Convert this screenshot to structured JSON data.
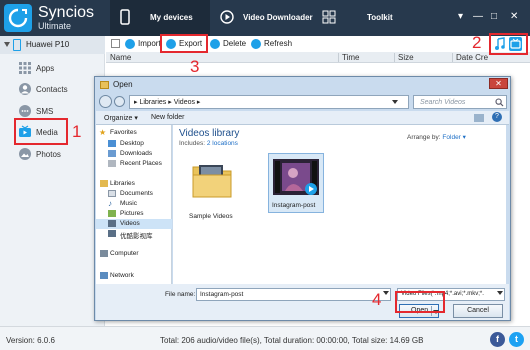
{
  "app": {
    "title": "Syncios",
    "subtitle": "Ultimate",
    "tabs": [
      {
        "label": "My devices",
        "icon": "phone-icon"
      },
      {
        "label": "Video Downloader",
        "icon": "play-icon"
      },
      {
        "label": "Toolkit",
        "icon": "grid-icon"
      }
    ],
    "window_controls": [
      "▾",
      "—",
      "□",
      "✕"
    ],
    "accent": "#1ea0e8",
    "header_bg": "#27394d",
    "highlight": "#e4282e"
  },
  "sidebar": {
    "device": "Huawei P10",
    "items": [
      {
        "label": "Apps",
        "icon": "apps-icon"
      },
      {
        "label": "Contacts",
        "icon": "contacts-icon"
      },
      {
        "label": "SMS",
        "icon": "sms-icon"
      },
      {
        "label": "Media",
        "icon": "media-icon"
      },
      {
        "label": "Photos",
        "icon": "photos-icon"
      }
    ]
  },
  "toolbar": {
    "import": "Import",
    "export": "Export",
    "delete": "Delete",
    "refresh": "Refresh"
  },
  "list_header": {
    "name": "Name",
    "time": "Time",
    "size": "Size",
    "date": "Date Cre"
  },
  "annotations": {
    "one": "1",
    "two": "2",
    "three": "3",
    "four": "4"
  },
  "dialog": {
    "title": "Open",
    "close": "✕",
    "path": "▸  Libraries  ▸  Videos  ▸",
    "search_placeholder": "Search Videos",
    "organize": "Organize ▾",
    "new_folder": "New folder",
    "nav": [
      {
        "label": "Favorites",
        "icon": "star-icon",
        "group": true
      },
      {
        "label": "Desktop",
        "icon": "desktop-icon",
        "group": false
      },
      {
        "label": "Downloads",
        "icon": "downloads-icon",
        "group": false
      },
      {
        "label": "Recent Places",
        "icon": "recent-icon",
        "group": false
      },
      {
        "label": "Libraries",
        "icon": "libraries-icon",
        "group": true
      },
      {
        "label": "Documents",
        "icon": "documents-icon",
        "group": false
      },
      {
        "label": "Music",
        "icon": "music-icon",
        "group": false
      },
      {
        "label": "Pictures",
        "icon": "pictures-icon",
        "group": false
      },
      {
        "label": "Videos",
        "icon": "videos-icon",
        "group": false
      },
      {
        "label": "优酷影视库",
        "icon": "library-icon",
        "group": false
      },
      {
        "label": "Computer",
        "icon": "computer-icon",
        "group": true
      },
      {
        "label": "Network",
        "icon": "network-icon",
        "group": true
      }
    ],
    "library_title": "Videos library",
    "library_includes": "Includes:",
    "library_locations": "2 locations",
    "arrange_label": "Arrange by:",
    "arrange_value": "Folder ▾",
    "items": [
      {
        "label": "Sample Videos",
        "icon": "folder-icon"
      },
      {
        "label": "Instagram-post",
        "icon": "video-thumbnail"
      }
    ],
    "file_name_label": "File name:",
    "file_name_value": "Instagram-post",
    "file_type": "Video Files(*.mp4;*.avi;*.mkv;*.",
    "open_button": "Open",
    "cancel_button": "Cancel"
  },
  "status": {
    "version": "Version: 6.0.6",
    "total": "Total: 206 audio/video file(s), Total duration: 00:00:00, Total size: 14.69 GB",
    "facebook": "f",
    "twitter": "t"
  }
}
